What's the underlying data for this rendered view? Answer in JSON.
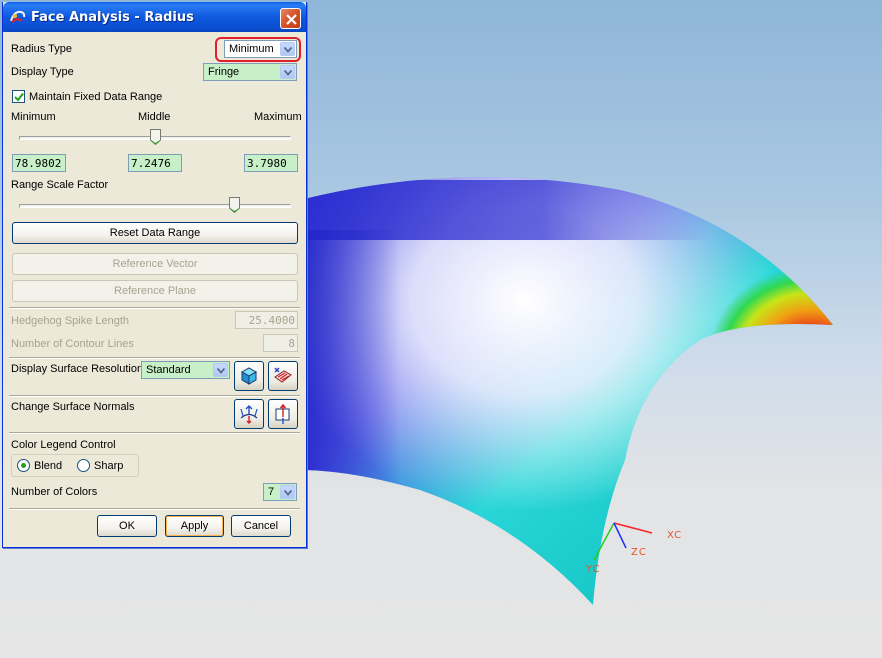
{
  "dialog": {
    "title": "Face Analysis - Radius",
    "radius_type": {
      "label": "Radius Type",
      "value": "Minimum"
    },
    "display_type": {
      "label": "Display Type",
      "value": "Fringe"
    },
    "maintain_range": {
      "label": "Maintain Fixed Data Range",
      "checked": true
    },
    "range": {
      "min_label": "Minimum",
      "mid_label": "Middle",
      "max_label": "Maximum",
      "min_value": "78.9802",
      "mid_value": "7.2476",
      "max_value": "3.7980",
      "slider_level": 0.5
    },
    "scale": {
      "label": "Range Scale Factor",
      "slider_level": 0.8
    },
    "buttons": {
      "reset": "Reset Data Range",
      "reference_vector": "Reference Vector",
      "reference_plane": "Reference Plane",
      "ok": "OK",
      "apply": "Apply",
      "cancel": "Cancel"
    },
    "hedgehog": {
      "label": "Hedgehog Spike Length",
      "value": "25.4000"
    },
    "contours": {
      "label": "Number of Contour Lines",
      "value": "8"
    },
    "surface_resolution": {
      "label": "Display Surface Resolution",
      "value": "Standard"
    },
    "normals": {
      "label": "Change Surface Normals"
    },
    "legend": {
      "label": "Color Legend Control",
      "options": [
        "Blend",
        "Sharp"
      ],
      "selected": "Blend"
    },
    "num_colors": {
      "label": "Number of Colors",
      "value": "7"
    }
  },
  "triad": {
    "x": "XC",
    "y": "YC",
    "z": "ZC"
  },
  "icons": [
    "app-icon",
    "close-icon",
    "chevron-down-icon",
    "check-icon",
    "shaded-cube-icon",
    "hatched-surface-icon",
    "reverse-normals-icon",
    "specify-normal-icon"
  ],
  "colors": {
    "highlight": "#e0202a",
    "field_green": "#c8f0c8",
    "title_blue": "#0a4dcf"
  }
}
